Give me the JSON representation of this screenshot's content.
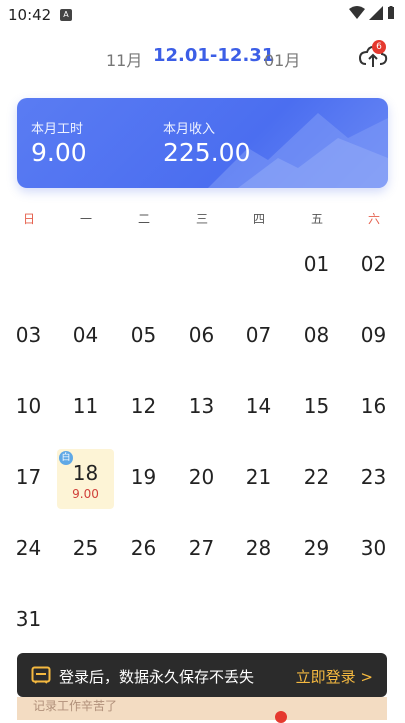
{
  "status_bar": {
    "time": "10:42",
    "app_icon_letter": "A"
  },
  "month_nav": {
    "prev": "11月",
    "current": "12.01-12.31",
    "next": "01月"
  },
  "sync": {
    "badge_count": "6",
    "icon": "cloud-upload-icon"
  },
  "summary": {
    "hours_label": "本月工时",
    "hours_value": "9.00",
    "income_label": "本月收入",
    "income_value": "225.00"
  },
  "weekdays": [
    "日",
    "一",
    "二",
    "三",
    "四",
    "五",
    "六"
  ],
  "calendar": {
    "weeks": [
      [
        "",
        "",
        "",
        "",
        "",
        "01",
        "02"
      ],
      [
        "03",
        "04",
        "05",
        "06",
        "07",
        "08",
        "09"
      ],
      [
        "10",
        "11",
        "12",
        "13",
        "14",
        "15",
        "16"
      ],
      [
        "17",
        "18",
        "19",
        "20",
        "21",
        "22",
        "23"
      ],
      [
        "24",
        "25",
        "26",
        "27",
        "28",
        "29",
        "30"
      ],
      [
        "31",
        "",
        "",
        "",
        "",
        "",
        ""
      ]
    ],
    "highlight_day": {
      "day": "18",
      "badge": "白",
      "hours": "9.00"
    }
  },
  "login_banner": {
    "text": "登录后，数据永久保存不丢失",
    "action": "立即登录 >"
  },
  "bottom_hint": "记录工作辛苦了"
}
